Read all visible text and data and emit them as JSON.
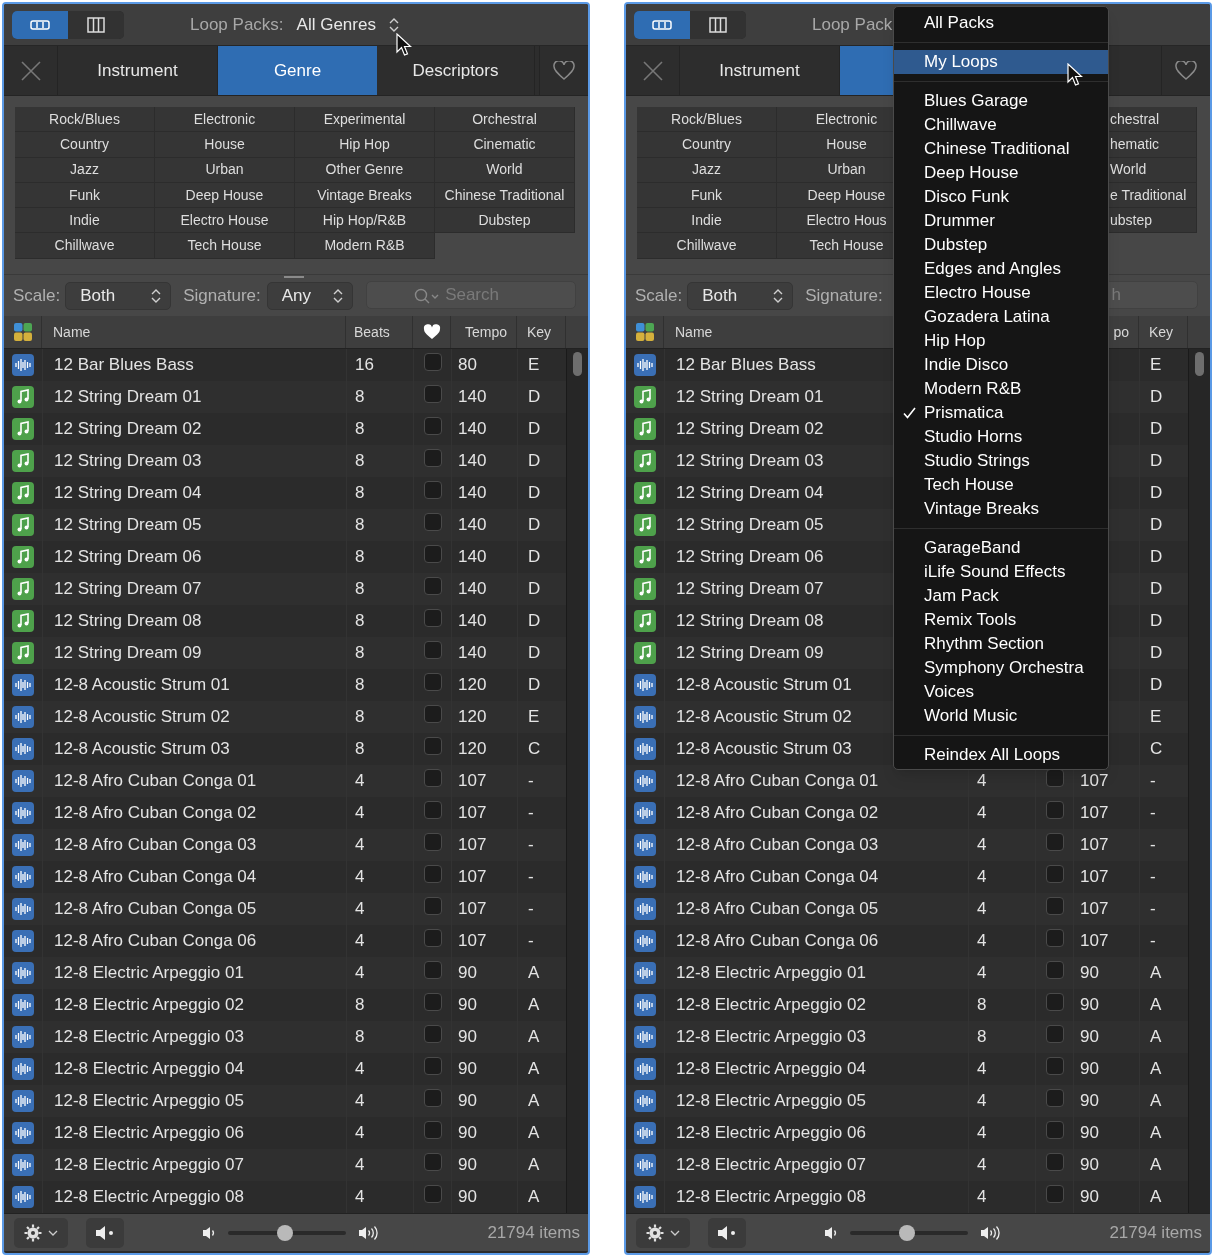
{
  "panels": [
    {
      "view_buttons": [
        {
          "selected": true
        },
        {
          "selected": false
        }
      ],
      "title": {
        "label": "Loop Packs:",
        "value": "All Genres"
      },
      "tabs": [
        {
          "label": "Instrument",
          "selected": false
        },
        {
          "label": "Genre",
          "selected": true
        },
        {
          "label": "Descriptors",
          "selected": false
        }
      ],
      "genre_grid": {
        "column_1": [
          "Rock/Blues",
          "Country",
          "Jazz",
          "Funk",
          "Indie",
          "Chillwave"
        ],
        "column_2": [
          "Electronic",
          "House",
          "Urban",
          "Deep House",
          "Electro House",
          "Tech House"
        ],
        "column_3": [
          "Experimental",
          "Hip Hop",
          "Other Genre",
          "Vintage Breaks",
          "Hip Hop/R&B",
          "Modern R&B"
        ],
        "column_4": [
          "Orchestral",
          "Cinematic",
          "World",
          "Chinese Traditional",
          "Dubstep"
        ]
      },
      "filters": {
        "scale": {
          "label": "Scale:",
          "value": "Both"
        },
        "signature": {
          "label": "Signature:",
          "value": "Any"
        },
        "search": {
          "placeholder": "Search"
        }
      },
      "columns": {
        "name": "Name",
        "beats": "Beats",
        "tempo": "Tempo",
        "key": "Key"
      },
      "rows": [
        {
          "kind": "audio",
          "name": "12 Bar Blues Bass",
          "beats": "16",
          "favorite": false,
          "tempo": "80",
          "key": "E"
        },
        {
          "kind": "midi",
          "name": "12 String Dream 01",
          "beats": "8",
          "favorite": false,
          "tempo": "140",
          "key": "D"
        },
        {
          "kind": "midi",
          "name": "12 String Dream 02",
          "beats": "8",
          "favorite": false,
          "tempo": "140",
          "key": "D"
        },
        {
          "kind": "midi",
          "name": "12 String Dream 03",
          "beats": "8",
          "favorite": false,
          "tempo": "140",
          "key": "D"
        },
        {
          "kind": "midi",
          "name": "12 String Dream 04",
          "beats": "8",
          "favorite": false,
          "tempo": "140",
          "key": "D"
        },
        {
          "kind": "midi",
          "name": "12 String Dream 05",
          "beats": "8",
          "favorite": false,
          "tempo": "140",
          "key": "D"
        },
        {
          "kind": "midi",
          "name": "12 String Dream 06",
          "beats": "8",
          "favorite": false,
          "tempo": "140",
          "key": "D"
        },
        {
          "kind": "midi",
          "name": "12 String Dream 07",
          "beats": "8",
          "favorite": false,
          "tempo": "140",
          "key": "D"
        },
        {
          "kind": "midi",
          "name": "12 String Dream 08",
          "beats": "8",
          "favorite": false,
          "tempo": "140",
          "key": "D"
        },
        {
          "kind": "midi",
          "name": "12 String Dream 09",
          "beats": "8",
          "favorite": false,
          "tempo": "140",
          "key": "D"
        },
        {
          "kind": "audio",
          "name": "12-8 Acoustic Strum 01",
          "beats": "8",
          "favorite": false,
          "tempo": "120",
          "key": "D"
        },
        {
          "kind": "audio",
          "name": "12-8 Acoustic Strum 02",
          "beats": "8",
          "favorite": false,
          "tempo": "120",
          "key": "E"
        },
        {
          "kind": "audio",
          "name": "12-8 Acoustic Strum 03",
          "beats": "8",
          "favorite": false,
          "tempo": "120",
          "key": "C"
        },
        {
          "kind": "audio",
          "name": "12-8 Afro Cuban Conga 01",
          "beats": "4",
          "favorite": false,
          "tempo": "107",
          "key": "-"
        },
        {
          "kind": "audio",
          "name": "12-8 Afro Cuban Conga 02",
          "beats": "4",
          "favorite": false,
          "tempo": "107",
          "key": "-"
        },
        {
          "kind": "audio",
          "name": "12-8 Afro Cuban Conga 03",
          "beats": "4",
          "favorite": false,
          "tempo": "107",
          "key": "-"
        },
        {
          "kind": "audio",
          "name": "12-8 Afro Cuban Conga 04",
          "beats": "4",
          "favorite": false,
          "tempo": "107",
          "key": "-"
        },
        {
          "kind": "audio",
          "name": "12-8 Afro Cuban Conga 05",
          "beats": "4",
          "favorite": false,
          "tempo": "107",
          "key": "-"
        },
        {
          "kind": "audio",
          "name": "12-8 Afro Cuban Conga 06",
          "beats": "4",
          "favorite": false,
          "tempo": "107",
          "key": "-"
        },
        {
          "kind": "audio",
          "name": "12-8 Electric Arpeggio 01",
          "beats": "4",
          "favorite": false,
          "tempo": "90",
          "key": "A"
        },
        {
          "kind": "audio",
          "name": "12-8 Electric Arpeggio 02",
          "beats": "8",
          "favorite": false,
          "tempo": "90",
          "key": "A"
        },
        {
          "kind": "audio",
          "name": "12-8 Electric Arpeggio 03",
          "beats": "8",
          "favorite": false,
          "tempo": "90",
          "key": "A"
        },
        {
          "kind": "audio",
          "name": "12-8 Electric Arpeggio 04",
          "beats": "4",
          "favorite": false,
          "tempo": "90",
          "key": "A"
        },
        {
          "kind": "audio",
          "name": "12-8 Electric Arpeggio 05",
          "beats": "4",
          "favorite": false,
          "tempo": "90",
          "key": "A"
        },
        {
          "kind": "audio",
          "name": "12-8 Electric Arpeggio 06",
          "beats": "4",
          "favorite": false,
          "tempo": "90",
          "key": "A"
        },
        {
          "kind": "audio",
          "name": "12-8 Electric Arpeggio 07",
          "beats": "4",
          "favorite": false,
          "tempo": "90",
          "key": "A"
        },
        {
          "kind": "audio",
          "name": "12-8 Electric Arpeggio 08",
          "beats": "4",
          "favorite": false,
          "tempo": "90",
          "key": "A"
        }
      ],
      "footer": {
        "volume": {
          "level": 0.48
        },
        "count": "21794 items"
      }
    },
    {
      "view_buttons": [
        {
          "selected": true
        },
        {
          "selected": false
        }
      ],
      "title": {
        "label": "Loop Pack"
      },
      "tabs": [
        {
          "label": "Instrument",
          "selected": false
        },
        {
          "selected": true
        }
      ],
      "genre_grid": {
        "column_1": [
          "Rock/Blues",
          "Country",
          "Jazz",
          "Funk",
          "Indie",
          "Chillwave"
        ],
        "column_2": [
          "Electronic",
          "House",
          "Urban",
          "Deep House",
          "Electro Hous",
          "Tech House"
        ],
        "column_4": [
          "chestral",
          "hematic",
          "World",
          "e Traditional",
          "ubstep"
        ]
      },
      "filters": {
        "scale": {
          "label": "Scale:",
          "value": "Both"
        },
        "signature": {
          "label": "Signature:"
        },
        "search": {
          "placeholder": "h"
        }
      },
      "columns": {
        "name": "Name",
        "tempo": "po",
        "key": "Key"
      },
      "rows": [
        {
          "kind": "audio",
          "name": "12 Bar Blues Bass",
          "key": "E"
        },
        {
          "kind": "midi",
          "name": "12 String Dream 01",
          "key": "D"
        },
        {
          "kind": "midi",
          "name": "12 String Dream 02",
          "key": "D"
        },
        {
          "kind": "midi",
          "name": "12 String Dream 03",
          "key": "D"
        },
        {
          "kind": "midi",
          "name": "12 String Dream 04",
          "key": "D"
        },
        {
          "kind": "midi",
          "name": "12 String Dream 05",
          "key": "D"
        },
        {
          "kind": "midi",
          "name": "12 String Dream 06",
          "key": "D"
        },
        {
          "kind": "midi",
          "name": "12 String Dream 07",
          "key": "D"
        },
        {
          "kind": "midi",
          "name": "12 String Dream 08",
          "key": "D"
        },
        {
          "kind": "midi",
          "name": "12 String Dream 09",
          "key": "D"
        },
        {
          "kind": "audio",
          "name": "12-8 Acoustic Strum 01",
          "key": "D"
        },
        {
          "kind": "audio",
          "name": "12-8 Acoustic Strum 02",
          "key": "E"
        },
        {
          "kind": "audio",
          "name": "12-8 Acoustic Strum 03",
          "key": "C"
        },
        {
          "kind": "audio",
          "name": "12-8 Afro Cuban Conga 01",
          "beats": "4",
          "favorite": false,
          "tempo": "107",
          "key": "-"
        },
        {
          "kind": "audio",
          "name": "12-8 Afro Cuban Conga 02",
          "beats": "4",
          "favorite": false,
          "tempo": "107",
          "key": "-"
        },
        {
          "kind": "audio",
          "name": "12-8 Afro Cuban Conga 03",
          "beats": "4",
          "favorite": false,
          "tempo": "107",
          "key": "-"
        },
        {
          "kind": "audio",
          "name": "12-8 Afro Cuban Conga 04",
          "beats": "4",
          "favorite": false,
          "tempo": "107",
          "key": "-"
        },
        {
          "kind": "audio",
          "name": "12-8 Afro Cuban Conga 05",
          "beats": "4",
          "favorite": false,
          "tempo": "107",
          "key": "-"
        },
        {
          "kind": "audio",
          "name": "12-8 Afro Cuban Conga 06",
          "beats": "4",
          "favorite": false,
          "tempo": "107",
          "key": "-"
        },
        {
          "kind": "audio",
          "name": "12-8 Electric Arpeggio 01",
          "beats": "4",
          "favorite": false,
          "tempo": "90",
          "key": "A"
        },
        {
          "kind": "audio",
          "name": "12-8 Electric Arpeggio 02",
          "beats": "8",
          "favorite": false,
          "tempo": "90",
          "key": "A"
        },
        {
          "kind": "audio",
          "name": "12-8 Electric Arpeggio 03",
          "beats": "8",
          "favorite": false,
          "tempo": "90",
          "key": "A"
        },
        {
          "kind": "audio",
          "name": "12-8 Electric Arpeggio 04",
          "beats": "4",
          "favorite": false,
          "tempo": "90",
          "key": "A"
        },
        {
          "kind": "audio",
          "name": "12-8 Electric Arpeggio 05",
          "beats": "4",
          "favorite": false,
          "tempo": "90",
          "key": "A"
        },
        {
          "kind": "audio",
          "name": "12-8 Electric Arpeggio 06",
          "beats": "4",
          "favorite": false,
          "tempo": "90",
          "key": "A"
        },
        {
          "kind": "audio",
          "name": "12-8 Electric Arpeggio 07",
          "beats": "4",
          "favorite": false,
          "tempo": "90",
          "key": "A"
        },
        {
          "kind": "audio",
          "name": "12-8 Electric Arpeggio 08",
          "beats": "4",
          "favorite": false,
          "tempo": "90",
          "key": "A"
        }
      ],
      "footer": {
        "volume": {
          "level": 0.48
        },
        "count": "21794 items"
      },
      "menu": {
        "groups": [
          {
            "items": [
              {
                "label": "All Packs",
                "checked": false,
                "selected": false
              }
            ]
          },
          {
            "items": [
              {
                "label": "My Loops",
                "checked": false,
                "selected": true
              }
            ]
          },
          {
            "items": [
              {
                "label": "Blues Garage",
                "checked": false,
                "selected": false
              },
              {
                "label": "Chillwave",
                "checked": false,
                "selected": false
              },
              {
                "label": "Chinese Traditional",
                "checked": false,
                "selected": false
              },
              {
                "label": "Deep House",
                "checked": false,
                "selected": false
              },
              {
                "label": "Disco Funk",
                "checked": false,
                "selected": false
              },
              {
                "label": "Drummer",
                "checked": false,
                "selected": false
              },
              {
                "label": "Dubstep",
                "checked": false,
                "selected": false
              },
              {
                "label": "Edges and Angles",
                "checked": false,
                "selected": false
              },
              {
                "label": "Electro House",
                "checked": false,
                "selected": false
              },
              {
                "label": "Gozadera Latina",
                "checked": false,
                "selected": false
              },
              {
                "label": "Hip Hop",
                "checked": false,
                "selected": false
              },
              {
                "label": "Indie Disco",
                "checked": false,
                "selected": false
              },
              {
                "label": "Modern R&B",
                "checked": false,
                "selected": false
              },
              {
                "label": "Prismatica",
                "checked": true,
                "selected": false
              },
              {
                "label": "Studio Horns",
                "checked": false,
                "selected": false
              },
              {
                "label": "Studio Strings",
                "checked": false,
                "selected": false
              },
              {
                "label": "Tech House",
                "checked": false,
                "selected": false
              },
              {
                "label": "Vintage Breaks",
                "checked": false,
                "selected": false
              }
            ]
          },
          {
            "items": [
              {
                "label": "GarageBand",
                "checked": false,
                "selected": false
              },
              {
                "label": "iLife Sound Effects",
                "checked": false,
                "selected": false
              },
              {
                "label": "Jam Pack",
                "checked": false,
                "selected": false
              },
              {
                "label": "Remix Tools",
                "checked": false,
                "selected": false
              },
              {
                "label": "Rhythm Section",
                "checked": false,
                "selected": false
              },
              {
                "label": "Symphony Orchestra",
                "checked": false,
                "selected": false
              },
              {
                "label": "Voices",
                "checked": false,
                "selected": false
              },
              {
                "label": "World Music",
                "checked": false,
                "selected": false
              }
            ]
          },
          {
            "items": [
              {
                "label": "Reindex All Loops",
                "checked": false,
                "selected": false
              }
            ]
          }
        ]
      }
    }
  ]
}
